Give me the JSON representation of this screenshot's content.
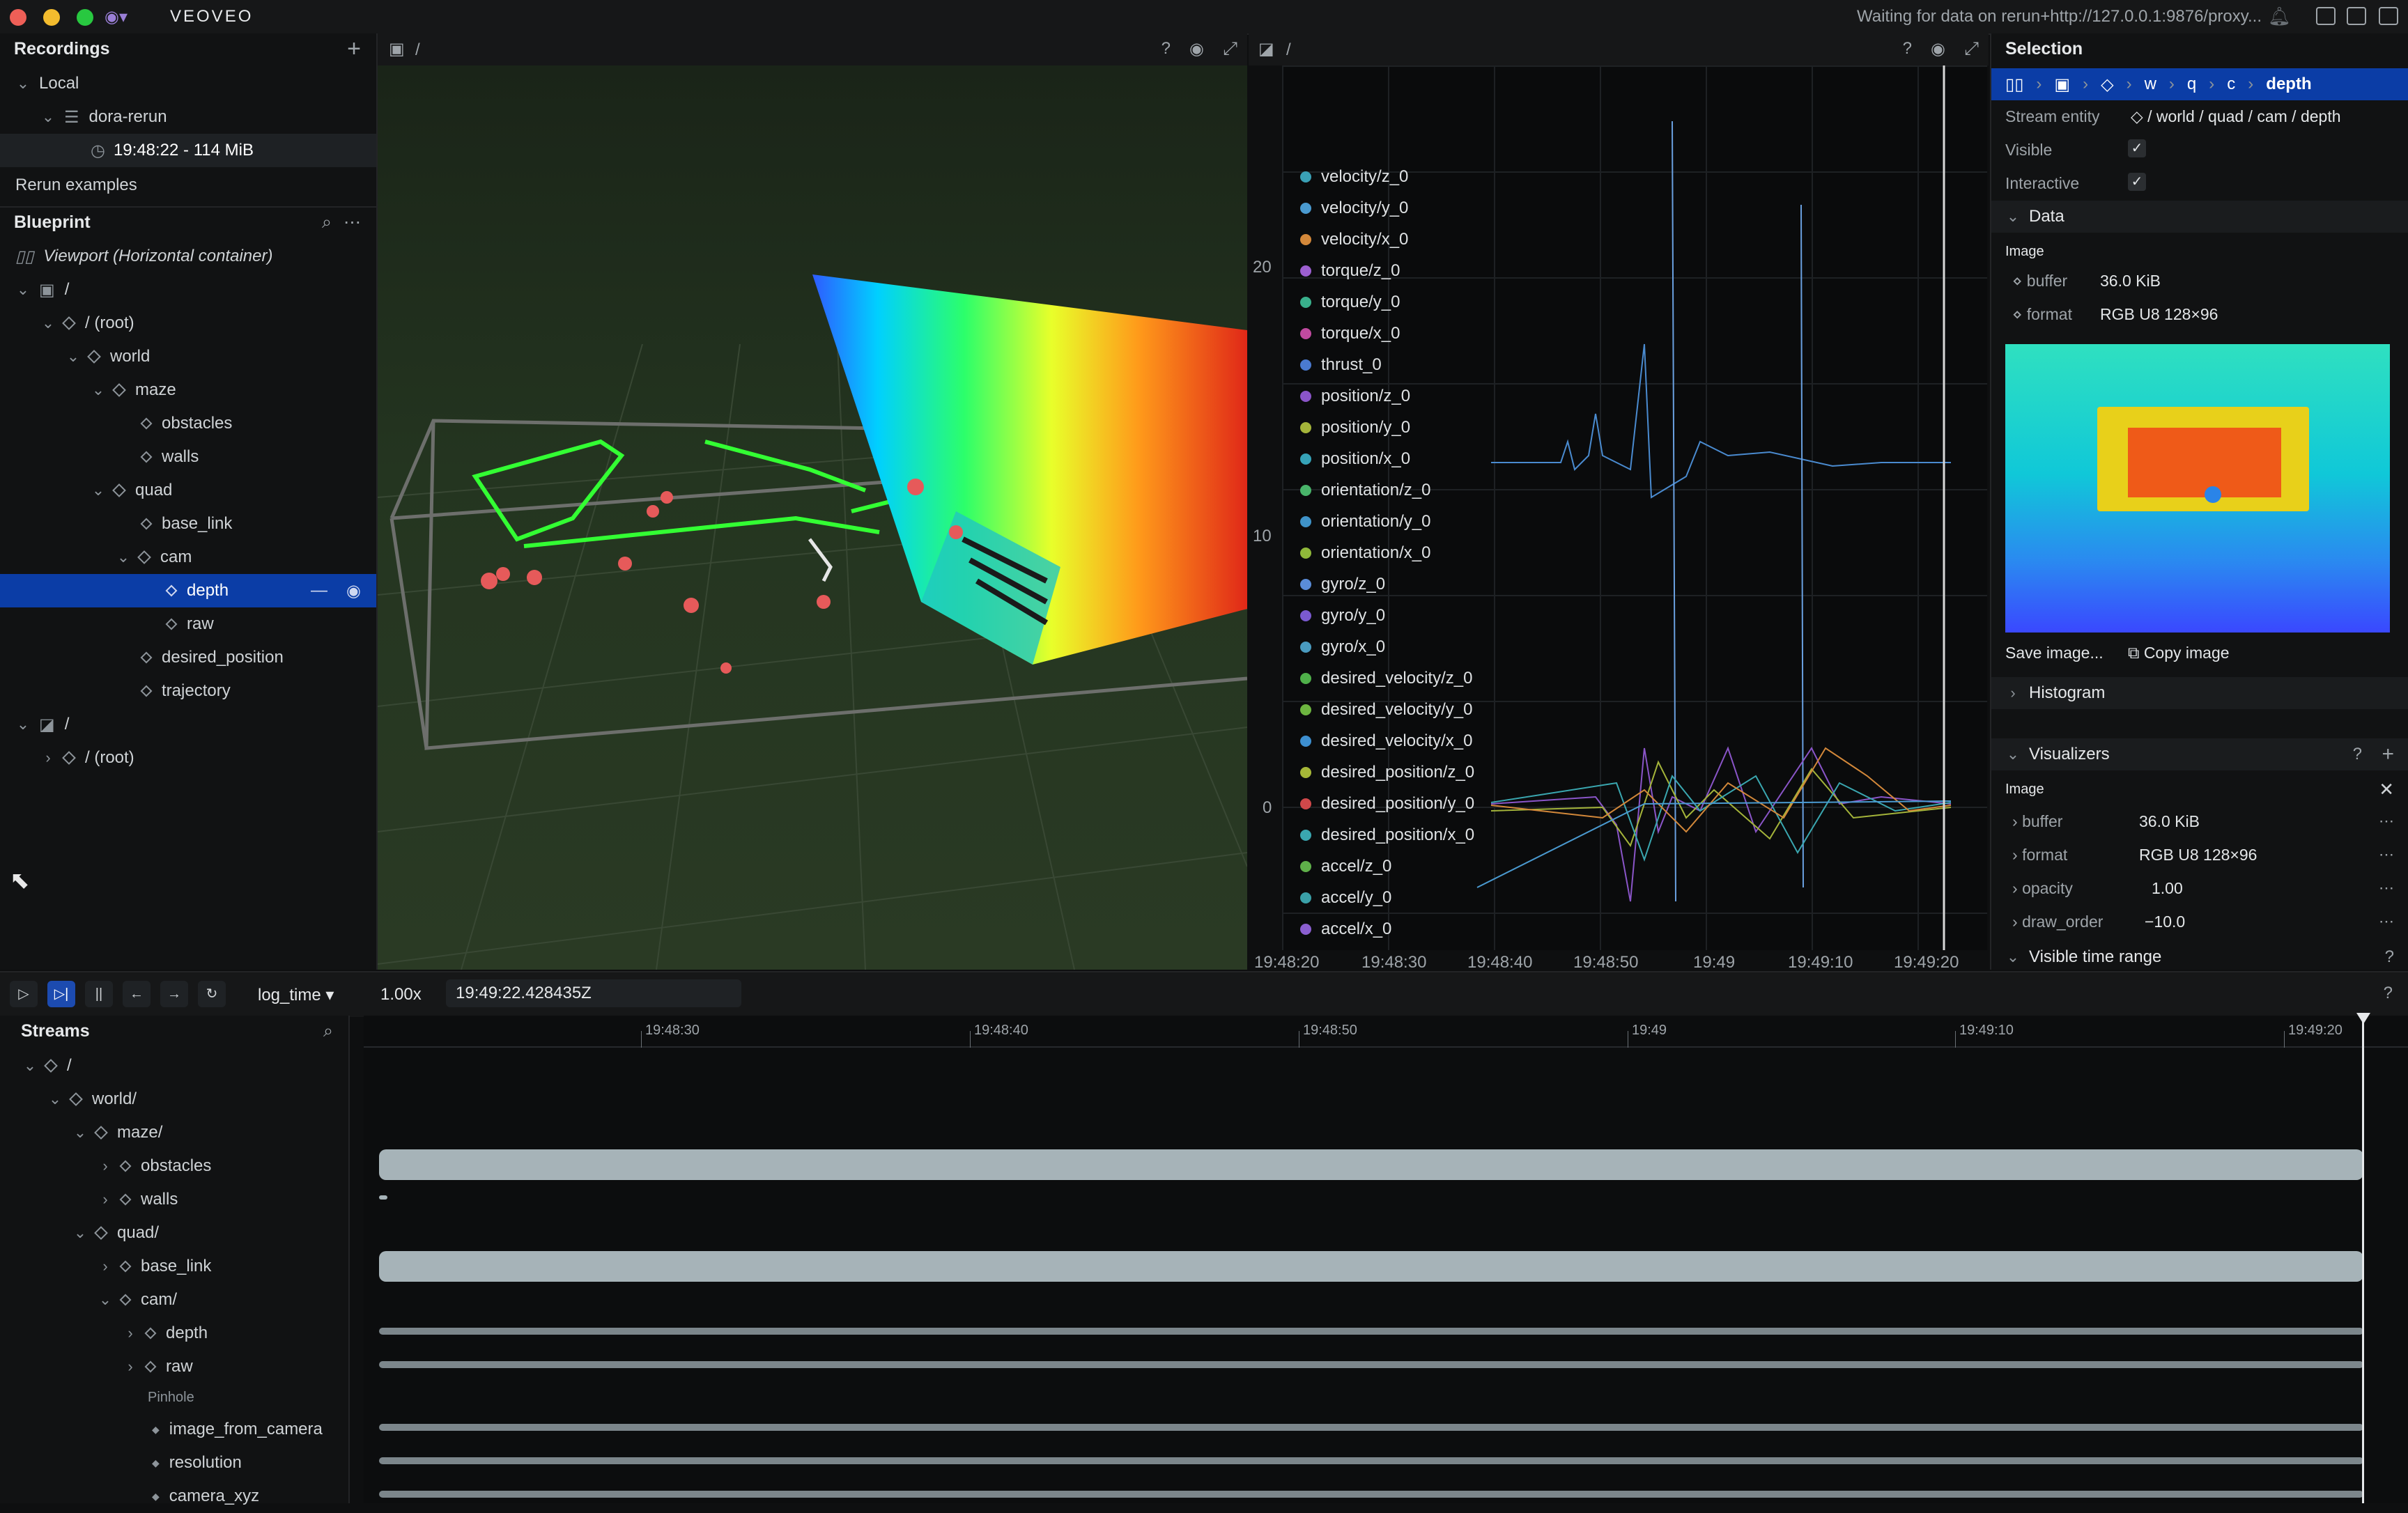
{
  "titlebar": {
    "app_name": "VEOVEO",
    "status": "Waiting for data on rerun+http://127.0.0.1:9876/proxy..."
  },
  "recordings": {
    "title": "Recordings",
    "group": "Local",
    "recording": "dora-rerun",
    "entry": "19:48:22 - 114 MiB",
    "examples": "Rerun examples"
  },
  "blueprint": {
    "title": "Blueprint",
    "viewport": "Viewport (Horizontal container)",
    "items": [
      "/",
      "/ (root)",
      "world",
      "maze",
      "obstacles",
      "walls",
      "quad",
      "base_link",
      "cam",
      "depth",
      "raw",
      "desired_position",
      "trajectory",
      "/",
      "/ (root)"
    ]
  },
  "view3d": {
    "path": "/"
  },
  "timeseries": {
    "path": "/",
    "legend": [
      {
        "name": "velocity/z_0",
        "color": "#3aa0b5"
      },
      {
        "name": "velocity/y_0",
        "color": "#4a9ad0"
      },
      {
        "name": "velocity/x_0",
        "color": "#d3883a"
      },
      {
        "name": "torque/z_0",
        "color": "#9c5fd0"
      },
      {
        "name": "torque/y_0",
        "color": "#39b08c"
      },
      {
        "name": "torque/x_0",
        "color": "#c04aa0"
      },
      {
        "name": "thrust_0",
        "color": "#4a7ad0"
      },
      {
        "name": "position/z_0",
        "color": "#8a55c8"
      },
      {
        "name": "position/y_0",
        "color": "#a4b43a"
      },
      {
        "name": "position/x_0",
        "color": "#36a3b8"
      },
      {
        "name": "orientation/z_0",
        "color": "#49b46a"
      },
      {
        "name": "orientation/y_0",
        "color": "#3f93c9"
      },
      {
        "name": "orientation/x_0",
        "color": "#8fb83a"
      },
      {
        "name": "gyro/z_0",
        "color": "#5a8cd8"
      },
      {
        "name": "gyro/y_0",
        "color": "#7a5ad0"
      },
      {
        "name": "gyro/x_0",
        "color": "#4a9bc0"
      },
      {
        "name": "desired_velocity/z_0",
        "color": "#4fb04a"
      },
      {
        "name": "desired_velocity/y_0",
        "color": "#6db540"
      },
      {
        "name": "desired_velocity/x_0",
        "color": "#3d8fd0"
      },
      {
        "name": "desired_position/z_0",
        "color": "#a6b838"
      },
      {
        "name": "desired_position/y_0",
        "color": "#d0484a"
      },
      {
        "name": "desired_position/x_0",
        "color": "#3aa7b0"
      },
      {
        "name": "accel/z_0",
        "color": "#5fb04a"
      },
      {
        "name": "accel/y_0",
        "color": "#3aa0a8"
      },
      {
        "name": "accel/x_0",
        "color": "#8b5fd0"
      }
    ],
    "yticks": [
      "20",
      "10",
      "0"
    ],
    "xticks": [
      "19:48:20",
      "19:48:30",
      "19:48:40",
      "19:48:50",
      "19:49",
      "19:49:10",
      "19:49:20"
    ]
  },
  "selection": {
    "title": "Selection",
    "breadcrumb": [
      "w",
      "q",
      "c",
      "depth"
    ],
    "stream_entity_label": "Stream entity",
    "stream_entity_value": "/ world / quad / cam / depth",
    "visible_label": "Visible",
    "interactive_label": "Interactive",
    "data_section": "Data",
    "image_label": "Image",
    "buffer_label": "buffer",
    "buffer_value": "36.0 KiB",
    "format_label": "format",
    "format_value": "RGB U8 128×96",
    "save_image": "Save image...",
    "copy_image": "Copy image",
    "histogram": "Histogram",
    "visualizers": "Visualizers",
    "viz_image": "Image",
    "opacity_label": "opacity",
    "opacity_value": "1.00",
    "draw_order_label": "draw_order",
    "draw_order_value": "−10.0",
    "visible_time_range": "Visible time range"
  },
  "timeline": {
    "timeline_name": "log_time",
    "speed": "1.00x",
    "current_time": "19:49:22.428435Z",
    "ticks": [
      "19:48:30",
      "19:48:40",
      "19:48:50",
      "19:49",
      "19:49:10",
      "19:49:20"
    ]
  },
  "streams": {
    "title": "Streams",
    "items": [
      "/",
      "world/",
      "maze/",
      "obstacles",
      "walls",
      "quad/",
      "base_link",
      "cam/",
      "depth",
      "raw",
      "Pinhole",
      "image_from_camera",
      "resolution",
      "camera_xyz"
    ]
  }
}
